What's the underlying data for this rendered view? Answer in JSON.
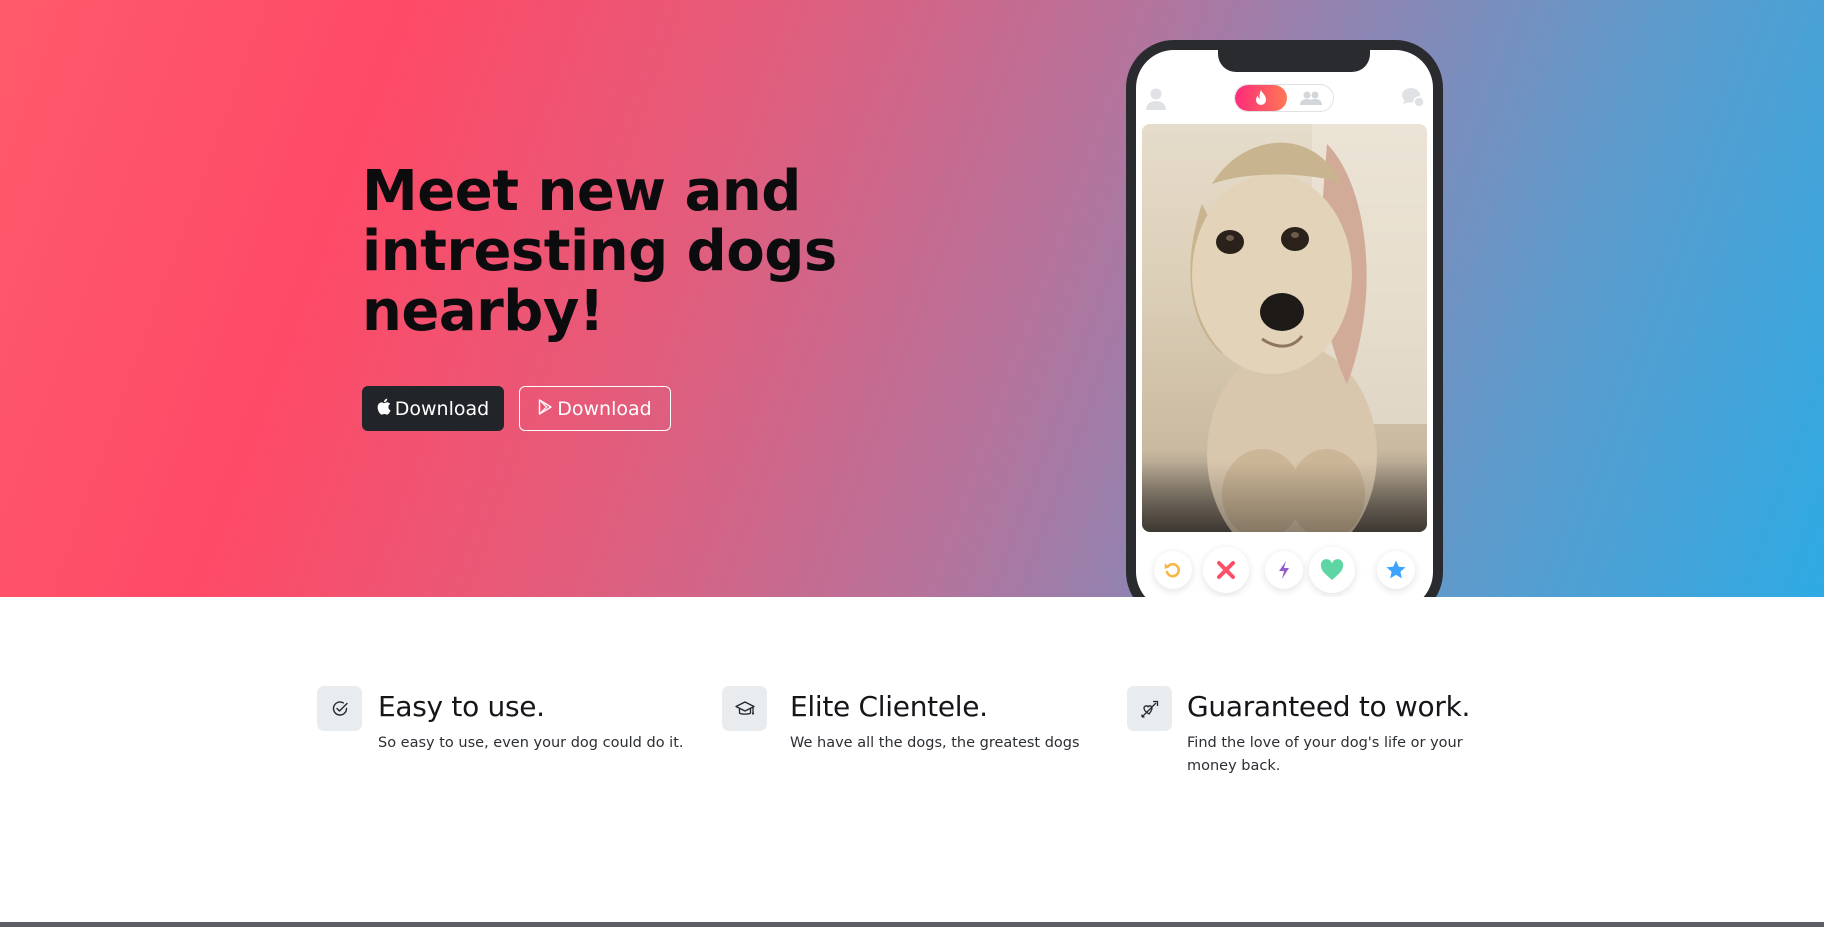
{
  "hero": {
    "headline": "Meet new and intresting dogs nearby!",
    "apple_button_label": "Download",
    "play_button_label": "Download"
  },
  "phone": {
    "icons": [
      "profile-icon",
      "flame-icon",
      "group-icon",
      "chat-icon"
    ],
    "actions": [
      "rewind-icon",
      "nope-icon",
      "boost-icon",
      "like-icon",
      "super-like-icon"
    ],
    "colors": {
      "toggle_gradient": [
        "#fd2b7b",
        "#ff7854"
      ],
      "rewind": "#f5b748",
      "nope": "#fd5068",
      "boost": "#915dd1",
      "like": "#5ed6a4",
      "super_like": "#3ca4ff"
    }
  },
  "features": [
    {
      "icon": "check-circle-icon",
      "title": "Easy to use.",
      "description": "So easy to use, even your dog could do it."
    },
    {
      "icon": "mortarboard-icon",
      "title": "Elite Clientele.",
      "description": "We have all the dogs, the greatest dogs"
    },
    {
      "icon": "heart-arrow-icon",
      "title": "Guaranteed to work.",
      "description": "Find the love of your dog's life or your money back."
    }
  ],
  "colors": {
    "hero_gradient": [
      "#fe5a6b",
      "#fe4a67",
      "#b8729a",
      "#2eaae3"
    ],
    "dark_button": "#212529",
    "feature_icon_bg": "#e9ecef"
  }
}
